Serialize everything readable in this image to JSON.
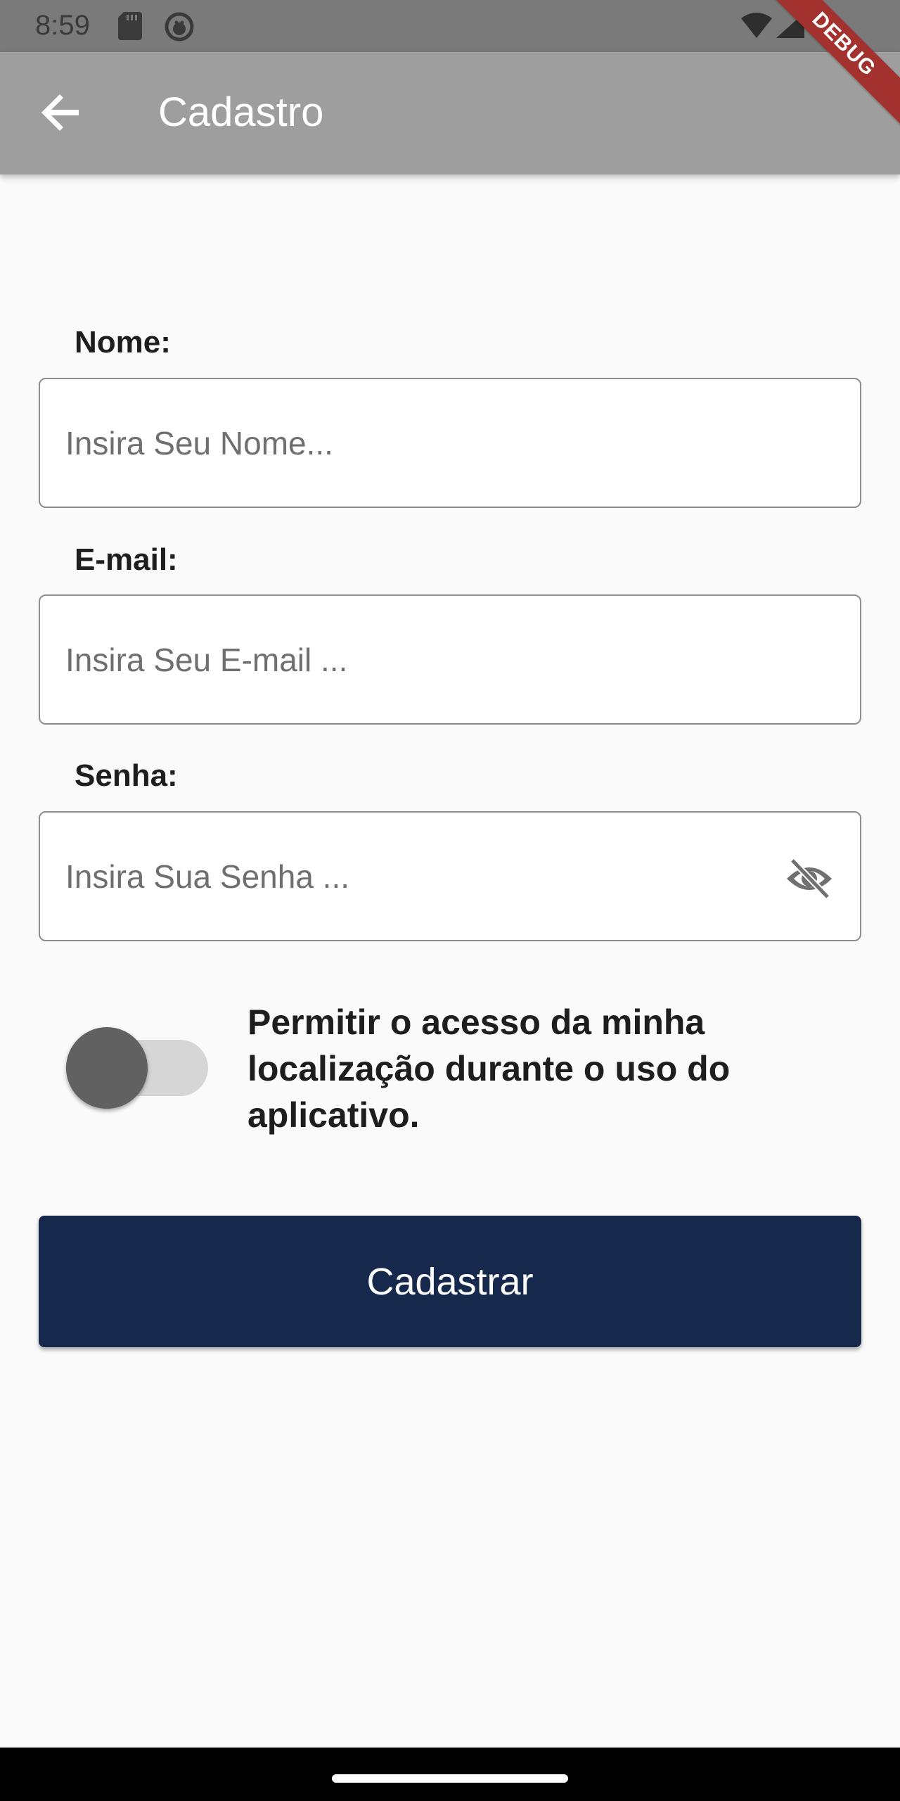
{
  "status_bar": {
    "time": "8:59",
    "icons": [
      "sd-card-icon",
      "android-debug-icon",
      "wifi-icon",
      "signal-icon",
      "battery-icon"
    ]
  },
  "app_bar": {
    "title": "Cadastro",
    "back_icon": "arrow-back-icon",
    "color": "#9e9e9e"
  },
  "debug_banner": "DEBUG",
  "form": {
    "nome": {
      "label": "Nome:",
      "placeholder": "Insira Seu Nome...",
      "value": ""
    },
    "email": {
      "label": "E-mail:",
      "placeholder": "Insira Seu E-mail ...",
      "value": ""
    },
    "senha": {
      "label": "Senha:",
      "placeholder": "Insira Sua Senha ...",
      "value": "",
      "toggle_icon": "visibility-off-icon"
    }
  },
  "location_toggle": {
    "label": "Permitir o acesso da minha localização durante o uso do aplicativo.",
    "enabled": false
  },
  "submit_button": {
    "label": "Cadastrar",
    "color": "#16284b"
  }
}
